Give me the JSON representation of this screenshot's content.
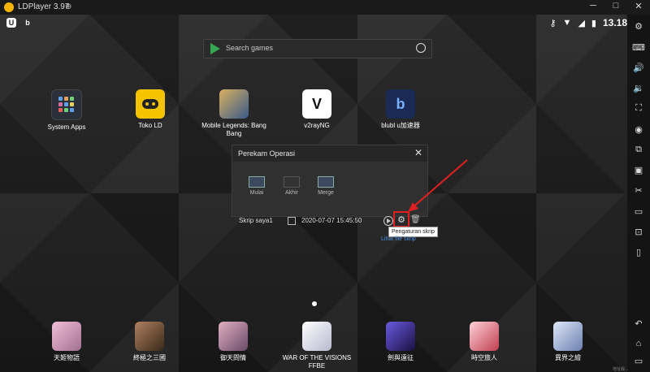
{
  "window": {
    "title": "LDPlayer 3.97",
    "controls": [
      "─",
      "□",
      "✕"
    ]
  },
  "statusbar": {
    "left_icons": [
      "U",
      "b"
    ],
    "time": "13.18"
  },
  "search": {
    "placeholder": "Search games"
  },
  "apps_top": [
    {
      "label": "System Apps",
      "icon": "grid-icon",
      "color": "#2a2f3a"
    },
    {
      "label": "Toko LD",
      "icon": "gamepad-icon",
      "color": "#f5c400"
    },
    {
      "label": "Mobile Legends: Bang Bang",
      "icon": "mlbb-icon",
      "color": "#3a5a8a"
    },
    {
      "label": "v2rayNG",
      "icon": "v-icon",
      "color": "#ffffff"
    },
    {
      "label": "blubl u加速器",
      "icon": "b-icon",
      "color": "#1a2a55"
    }
  ],
  "apps_bottom": [
    {
      "label": "天姬物語",
      "color": "#c99ab0"
    },
    {
      "label": "終極之三國",
      "color": "#7a5a3a"
    },
    {
      "label": "御天問情",
      "color": "#a07a8a"
    },
    {
      "label": "WAR OF THE VISIONS FFBE",
      "color": "#d8d8e8"
    },
    {
      "label": "劍與遠征",
      "color": "#4a3aa0"
    },
    {
      "label": "時空旅人",
      "color": "#c04050"
    },
    {
      "label": "異界之繪",
      "color": "#8aa0c0"
    }
  ],
  "dialog": {
    "title": "Perekam Operasi",
    "controls": [
      {
        "label": "Mulai"
      },
      {
        "label": "Akhir"
      },
      {
        "label": "Merge"
      }
    ],
    "script_name": "Skrip saya1",
    "script_date": "2020-07-07 15:45:50",
    "tooltip": "Pengaturan skrip",
    "link": "Lihat file skrip"
  },
  "sidebar_icons": [
    "gear-icon",
    "keyboard-icon",
    "volume-up-icon",
    "volume-down-icon",
    "fullscreen-icon",
    "record-icon",
    "multi-instance-icon",
    "apk-icon",
    "scissors-icon",
    "video-icon",
    "screenshot-icon",
    "rotate-icon",
    "back-icon",
    "home-icon",
    "recent-icon"
  ],
  "corner_text": "地址版..."
}
